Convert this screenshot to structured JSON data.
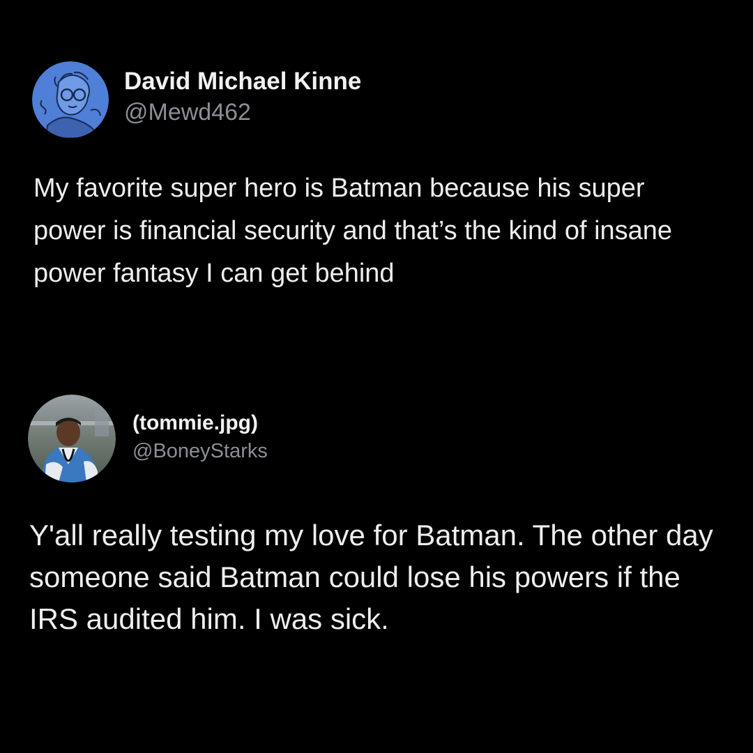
{
  "tweets": [
    {
      "display_name": "David Michael Kinne",
      "handle": "@Mewd462",
      "avatar_icon": "illustrated-portrait-avatar",
      "text": "My favorite super hero is Batman because his super power is financial security and that’s the kind of insane power fantasy I can get behind"
    },
    {
      "display_name": "(tommie.jpg)",
      "handle": "@BoneyStarks",
      "avatar_icon": "photo-portrait-avatar",
      "text": "Y'all really testing my love for Batman. The other day someone said Batman could lose his powers if the IRS audited him. I was sick."
    }
  ],
  "colors": {
    "background": "#000000",
    "display_name": "#f2f2f2",
    "handle": "#8b8f94",
    "body_text": "#eeeeee",
    "avatar_1_bg": "#4f7fd6"
  }
}
